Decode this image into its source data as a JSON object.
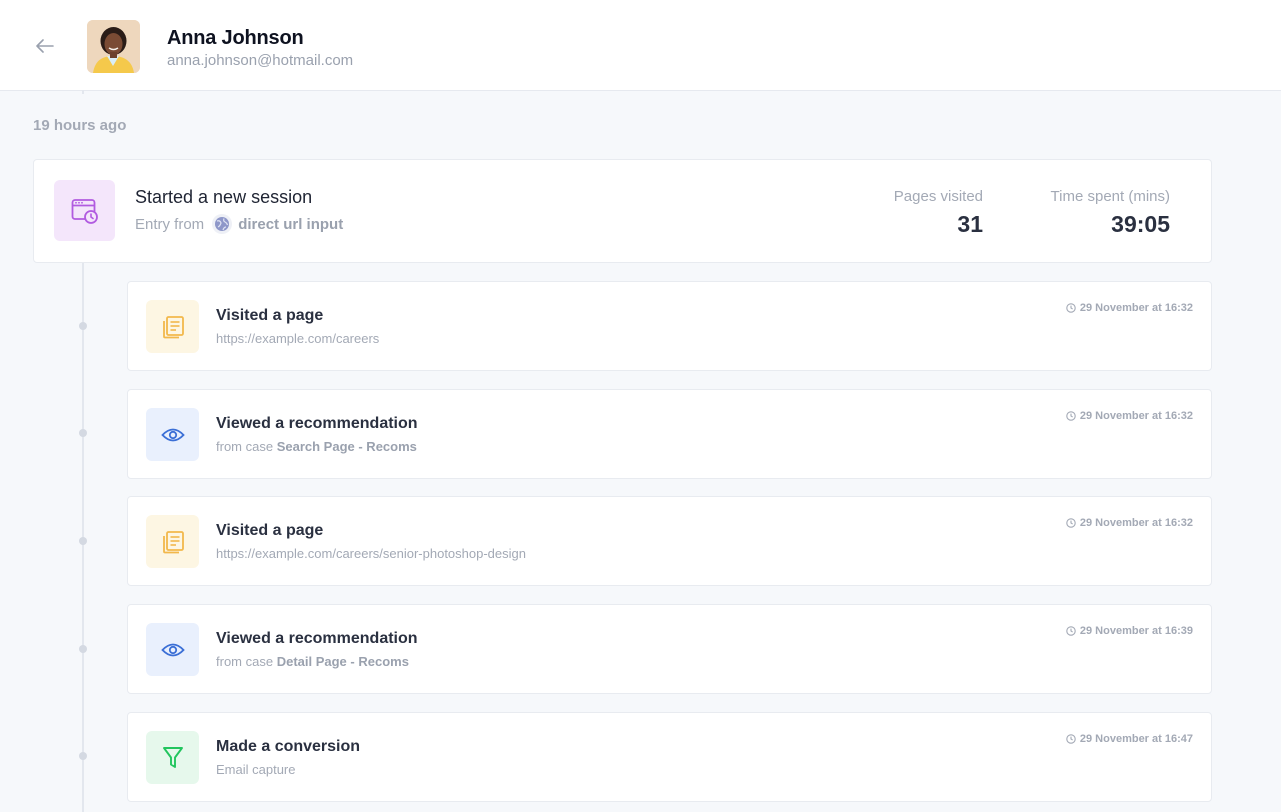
{
  "user": {
    "name": "Anna Johnson",
    "email": "anna.johnson@hotmail.com"
  },
  "session": {
    "time_ago": "19 hours ago",
    "title": "Started a new session",
    "entry_prefix": "Entry from",
    "entry_source": "direct url input",
    "pages_label": "Pages visited",
    "pages_value": "31",
    "time_label": "Time spent (mins)",
    "time_value": "39:05"
  },
  "events": [
    {
      "type": "page",
      "title": "Visited a page",
      "sub": "https://example.com/careers",
      "time": "29 November at 16:32"
    },
    {
      "type": "rec",
      "title": "Viewed a recommendation",
      "sub_prefix": "from case",
      "sub_bold": "Search Page - Recoms",
      "time": "29 November at 16:32"
    },
    {
      "type": "page",
      "title": "Visited a page",
      "sub": "https://example.com/careers/senior-photoshop-design",
      "time": "29 November at 16:32"
    },
    {
      "type": "rec",
      "title": "Viewed a recommendation",
      "sub_prefix": "from case",
      "sub_bold": "Detail Page - Recoms",
      "time": "29 November at 16:39"
    },
    {
      "type": "conv",
      "title": "Made a conversion",
      "sub": "Email capture",
      "time": "29 November at 16:47"
    }
  ],
  "colors": {
    "page_icon": "#f2b84b",
    "rec_icon": "#3b6fd6",
    "conv_icon": "#22c55e",
    "session_icon": "#b15be0"
  }
}
